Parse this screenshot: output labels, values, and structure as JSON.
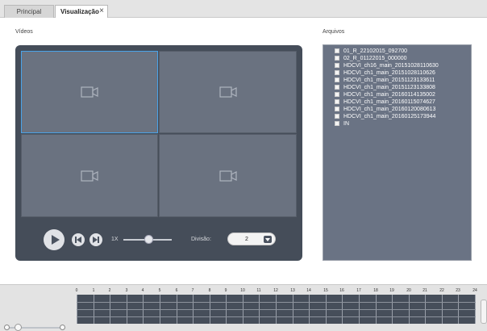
{
  "tabs": [
    {
      "label": "Principal"
    },
    {
      "label": "Visualização",
      "close": "×"
    }
  ],
  "videos_label": "Vídeos",
  "files_label": "Arquivos",
  "controls": {
    "speed": "1X",
    "division_label": "Divisão:",
    "division_value": "2"
  },
  "files": [
    "01_R_22102015_092700",
    "02_R_01122015_000000",
    "HDCVI_ch16_main_20151028110630",
    "HDCVI_ch1_main_20151028110626",
    "HDCVI_ch1_main_20151123133611",
    "HDCVI_ch1_main_20151123133808",
    "HDCVI_ch1_main_20160114135002",
    "HDCVI_ch1_main_20160115074627",
    "HDCVI_ch1_main_20160120080613",
    "HDCVI_ch1_main_20160125173944",
    "IN"
  ],
  "timeline": {
    "hours": [
      "0",
      "1",
      "2",
      "3",
      "4",
      "5",
      "6",
      "7",
      "8",
      "9",
      "10",
      "11",
      "12",
      "13",
      "14",
      "15",
      "16",
      "17",
      "18",
      "19",
      "20",
      "21",
      "22",
      "23",
      "24"
    ]
  },
  "colors": {
    "player_bg": "#454d59",
    "cell_bg": "#6a7280",
    "selected_border": "#4aa3e8",
    "files_bg": "#6a7384"
  }
}
